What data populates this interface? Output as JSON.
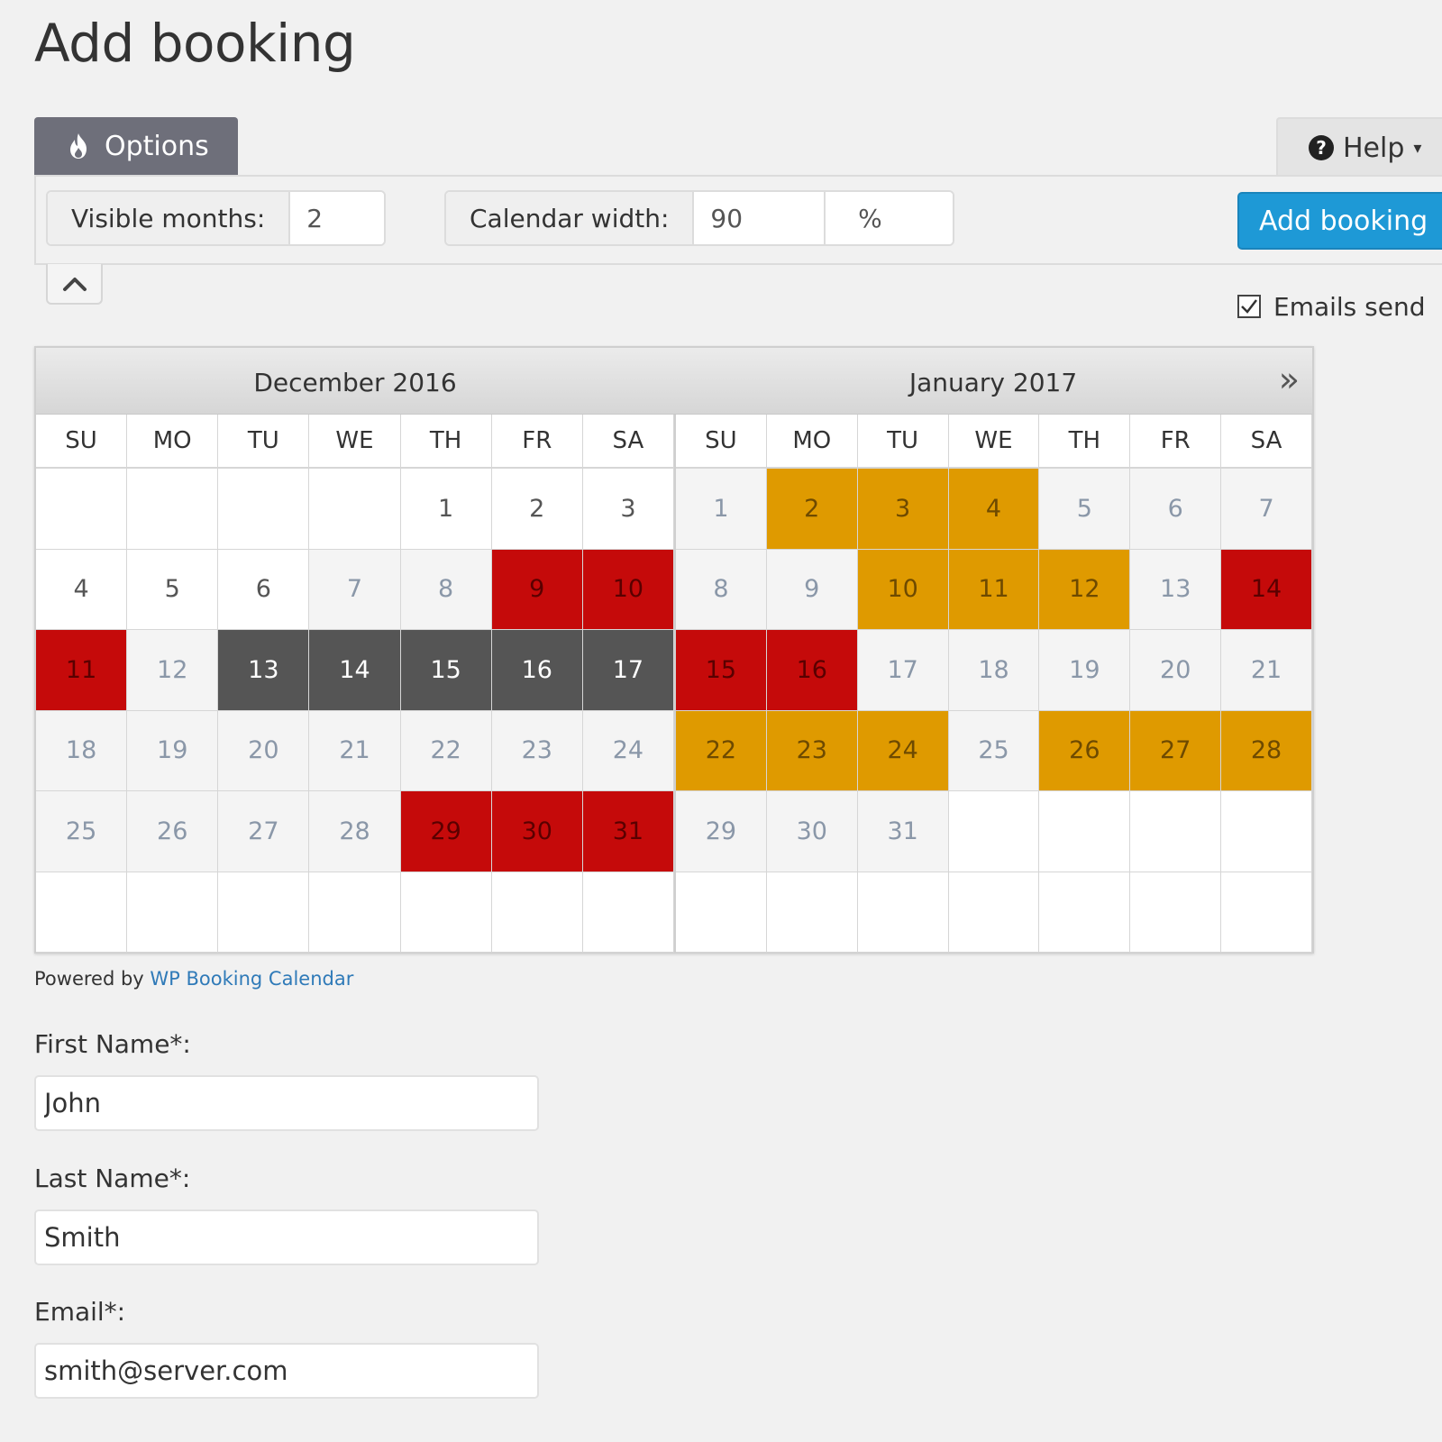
{
  "page_title": "Add booking",
  "tabs": {
    "options_label": "Options",
    "help_label": "Help"
  },
  "toolbar": {
    "visible_months_label": "Visible months:",
    "visible_months_value": "2",
    "calendar_width_label": "Calendar width:",
    "calendar_width_value": "90",
    "calendar_width_unit": "%",
    "add_booking_label": "Add booking",
    "emails_label": "Emails send",
    "emails_checked": true
  },
  "calendar": {
    "months": [
      {
        "title": "December 2016",
        "weekdays": [
          "SU",
          "MO",
          "TU",
          "WE",
          "TH",
          "FR",
          "SA"
        ],
        "weeks": [
          [
            [
              "",
              "empty"
            ],
            [
              "",
              "empty"
            ],
            [
              "",
              "empty"
            ],
            [
              "",
              "empty"
            ],
            [
              "1",
              "avail"
            ],
            [
              "2",
              "avail"
            ],
            [
              "3",
              "avail"
            ]
          ],
          [
            [
              "4",
              "avail"
            ],
            [
              "5",
              "avail"
            ],
            [
              "6",
              "avail"
            ],
            [
              "7",
              "unavail"
            ],
            [
              "8",
              "unavail"
            ],
            [
              "9",
              "booked"
            ],
            [
              "10",
              "booked"
            ]
          ],
          [
            [
              "11",
              "booked"
            ],
            [
              "12",
              "unavail"
            ],
            [
              "13",
              "selected"
            ],
            [
              "14",
              "selected"
            ],
            [
              "15",
              "selected"
            ],
            [
              "16",
              "selected"
            ],
            [
              "17",
              "selected"
            ]
          ],
          [
            [
              "18",
              "unavail"
            ],
            [
              "19",
              "unavail"
            ],
            [
              "20",
              "unavail"
            ],
            [
              "21",
              "unavail"
            ],
            [
              "22",
              "unavail"
            ],
            [
              "23",
              "unavail"
            ],
            [
              "24",
              "unavail"
            ]
          ],
          [
            [
              "25",
              "unavail"
            ],
            [
              "26",
              "unavail"
            ],
            [
              "27",
              "unavail"
            ],
            [
              "28",
              "unavail"
            ],
            [
              "29",
              "booked"
            ],
            [
              "30",
              "booked"
            ],
            [
              "31",
              "booked"
            ]
          ],
          [
            [
              "",
              "empty"
            ],
            [
              "",
              "empty"
            ],
            [
              "",
              "empty"
            ],
            [
              "",
              "empty"
            ],
            [
              "",
              "empty"
            ],
            [
              "",
              "empty"
            ],
            [
              "",
              "empty"
            ]
          ]
        ]
      },
      {
        "title": "January 2017",
        "weekdays": [
          "SU",
          "MO",
          "TU",
          "WE",
          "TH",
          "FR",
          "SA"
        ],
        "weeks": [
          [
            [
              "1",
              "unavail"
            ],
            [
              "2",
              "pending"
            ],
            [
              "3",
              "pending"
            ],
            [
              "4",
              "pending"
            ],
            [
              "5",
              "unavail"
            ],
            [
              "6",
              "unavail"
            ],
            [
              "7",
              "unavail"
            ]
          ],
          [
            [
              "8",
              "unavail"
            ],
            [
              "9",
              "unavail"
            ],
            [
              "10",
              "pending"
            ],
            [
              "11",
              "pending"
            ],
            [
              "12",
              "pending"
            ],
            [
              "13",
              "unavail"
            ],
            [
              "14",
              "booked"
            ]
          ],
          [
            [
              "15",
              "booked"
            ],
            [
              "16",
              "booked"
            ],
            [
              "17",
              "unavail"
            ],
            [
              "18",
              "unavail"
            ],
            [
              "19",
              "unavail"
            ],
            [
              "20",
              "unavail"
            ],
            [
              "21",
              "unavail"
            ]
          ],
          [
            [
              "22",
              "pending"
            ],
            [
              "23",
              "pending"
            ],
            [
              "24",
              "pending"
            ],
            [
              "25",
              "unavail"
            ],
            [
              "26",
              "pending"
            ],
            [
              "27",
              "pending"
            ],
            [
              "28",
              "pending"
            ]
          ],
          [
            [
              "29",
              "unavail"
            ],
            [
              "30",
              "unavail"
            ],
            [
              "31",
              "unavail"
            ],
            [
              "",
              "empty"
            ],
            [
              "",
              "empty"
            ],
            [
              "",
              "empty"
            ],
            [
              "",
              "empty"
            ]
          ],
          [
            [
              "",
              "empty"
            ],
            [
              "",
              "empty"
            ],
            [
              "",
              "empty"
            ],
            [
              "",
              "empty"
            ],
            [
              "",
              "empty"
            ],
            [
              "",
              "empty"
            ],
            [
              "",
              "empty"
            ]
          ]
        ]
      }
    ],
    "next_icon": "double-chevron-right-icon"
  },
  "footer": {
    "powered_by": "Powered by",
    "powered_link": "WP Booking Calendar"
  },
  "form": {
    "first_name_label": "First Name*:",
    "first_name_value": "John",
    "last_name_label": "Last Name*:",
    "last_name_value": "Smith",
    "email_label": "Email*:",
    "email_value": "smith@server.com"
  },
  "colors": {
    "tab_active": "#6e6f7a",
    "primary_button": "#1e99d6",
    "booked": "#c50a0a",
    "pending": "#df9a00",
    "selected": "#555555",
    "link": "#2f7ab8"
  }
}
